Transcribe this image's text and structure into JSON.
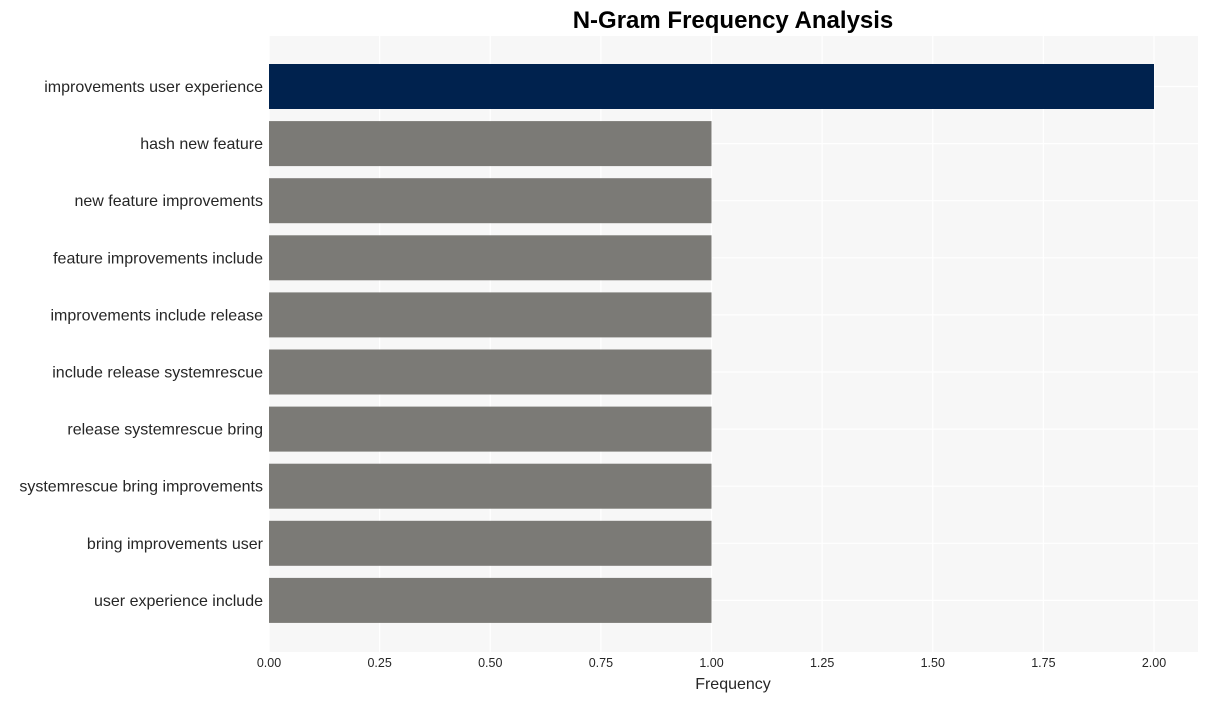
{
  "chart_data": {
    "type": "bar",
    "orientation": "horizontal",
    "title": "N-Gram Frequency Analysis",
    "xlabel": "Frequency",
    "ylabel": "",
    "xlim": [
      0,
      2.1
    ],
    "xticks": [
      0,
      0.25,
      0.5,
      0.75,
      1.0,
      1.25,
      1.5,
      1.75,
      2.0
    ],
    "xtick_labels": [
      "0.00",
      "0.25",
      "0.50",
      "0.75",
      "1.00",
      "1.25",
      "1.50",
      "1.75",
      "2.00"
    ],
    "grid": true,
    "legend": "none",
    "categories": [
      "improvements user experience",
      "hash new feature",
      "new feature improvements",
      "feature improvements include",
      "improvements include release",
      "include release systemrescue",
      "release systemrescue bring",
      "systemrescue bring improvements",
      "bring improvements user",
      "user experience include"
    ],
    "values": [
      2,
      1,
      1,
      1,
      1,
      1,
      1,
      1,
      1,
      1
    ],
    "colors": {
      "highlight": "#00224e",
      "default": "#7b7a76",
      "panel_background": "#f7f7f7",
      "grid": "#ffffff",
      "text": "#262626"
    }
  }
}
